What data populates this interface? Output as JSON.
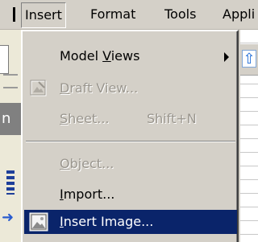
{
  "menubar": {
    "items": [
      {
        "label": "Insert",
        "active": true
      },
      {
        "label": "Format"
      },
      {
        "label": "Tools"
      },
      {
        "label": "Appli"
      }
    ]
  },
  "background": {
    "left_partial_text": "n"
  },
  "insert_menu": {
    "items": [
      {
        "label_pre": "Model ",
        "label_key": "V",
        "label_post": "iews",
        "enabled": true,
        "has_submenu": true
      },
      {
        "label_pre": "",
        "label_key": "D",
        "label_post": "raft View...",
        "enabled": false,
        "icon": "draft-view-icon"
      },
      {
        "label_pre": "",
        "label_key": "S",
        "label_post": "heet...",
        "shortcut": "Shift+N",
        "enabled": false
      },
      {
        "label_pre": "",
        "label_key": "O",
        "label_post": "bject...",
        "enabled": false
      },
      {
        "label_pre": "",
        "label_key": "I",
        "label_post": "mport...",
        "enabled": true
      },
      {
        "label_pre": "",
        "label_key": "I",
        "label_post": "nsert Image...",
        "enabled": true,
        "selected": true,
        "icon": "insert-image-icon"
      }
    ]
  },
  "colors": {
    "menu_bg": "#d4d0c8",
    "selection": "#0a246a",
    "disabled_text": "#9a968e"
  }
}
